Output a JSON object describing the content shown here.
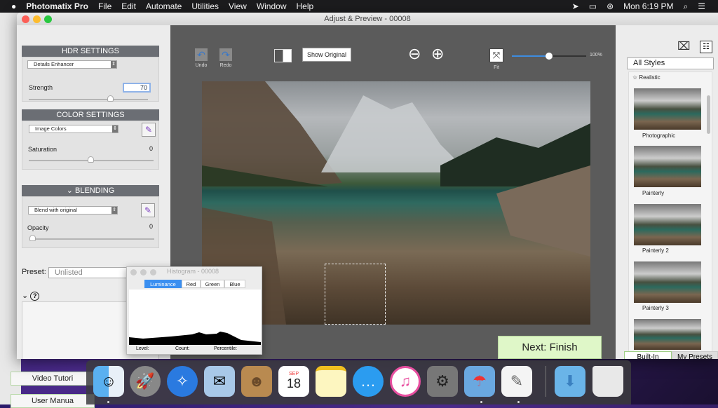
{
  "menubar": {
    "app": "Photomatix Pro",
    "items": [
      "File",
      "Edit",
      "Automate",
      "Utilities",
      "View",
      "Window",
      "Help"
    ],
    "clock": "Mon 6:19 PM"
  },
  "background_window": {
    "video_tutorials": "Video Tutori",
    "user_manual": "User Manua"
  },
  "window": {
    "title": "Adjust & Preview - 00008"
  },
  "hdr": {
    "header": "HDR SETTINGS",
    "method": "Details Enhancer",
    "strength_label": "Strength",
    "strength_value": "70",
    "strength": 70
  },
  "color": {
    "header": "COLOR SETTINGS",
    "mode": "Image Colors",
    "saturation_label": "Saturation",
    "saturation_value": "0"
  },
  "blending": {
    "header": "BLENDING",
    "mode": "Blend with original",
    "opacity_label": "Opacity",
    "opacity_value": "0"
  },
  "preset": {
    "label": "Preset:",
    "value": "Unlisted"
  },
  "toolbar": {
    "undo": "Undo",
    "redo": "Redo",
    "show_original": "Show Original",
    "fit": "Fit",
    "zoom": "100%",
    "zoom_fraction": 0.5
  },
  "next_button": "Next: Finish",
  "styles": {
    "filter": "All Styles",
    "items": [
      "Realistic",
      "Photographic",
      "Painterly",
      "Painterly 2",
      "Painterly 3"
    ],
    "tabs": [
      "Built-In",
      "My Presets"
    ]
  },
  "histogram": {
    "title": "Histogram - 00008",
    "tabs": [
      "Luminance",
      "Red",
      "Green",
      "Blue"
    ],
    "footer": [
      "Level:",
      "Count:",
      "Percentile:"
    ]
  },
  "dock": {
    "calendar_month": "SEP",
    "calendar_day": "18",
    "apps": [
      "Finder",
      "Launchpad",
      "Safari",
      "Mail",
      "Contacts",
      "Calendar",
      "Notes",
      "Messages",
      "iTunes",
      "System Preferences",
      "Preview",
      "TextEdit",
      "Downloads",
      "Trash"
    ]
  }
}
